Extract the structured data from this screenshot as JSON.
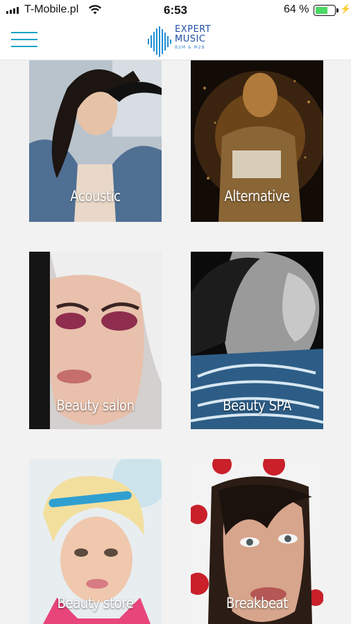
{
  "status_bar": {
    "carrier": "T-Mobile.pl",
    "time": "6:53",
    "battery_percent": "64 %",
    "battery_level": 0.64
  },
  "header": {
    "logo": {
      "line1": "EXPERT",
      "line2": "MUSIC",
      "line3": "B2M & M2B"
    }
  },
  "categories": [
    {
      "label": "Acoustic"
    },
    {
      "label": "Alternative"
    },
    {
      "label": "Beauty salon"
    },
    {
      "label": "Beauty SPA"
    },
    {
      "label": "Beauty store"
    },
    {
      "label": "Breakbeat"
    }
  ],
  "colors": {
    "accent": "#12a2c4",
    "logo_blue": "#1f4ea8",
    "background": "#f2f2f2"
  }
}
